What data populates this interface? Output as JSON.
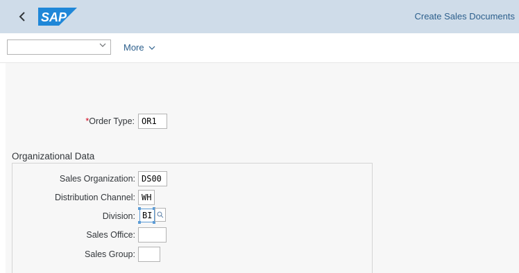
{
  "header": {
    "back_icon": "chevron-left-icon",
    "logo_text": "SAP",
    "title": "Create Sales Documents"
  },
  "toolbar": {
    "select_value": "",
    "more_label": "More"
  },
  "form": {
    "order_type": {
      "label": "Order Type:",
      "required": true,
      "value": "OR1"
    }
  },
  "organizational_data": {
    "title": "Organizational Data",
    "fields": [
      {
        "label": "Sales Organization:",
        "value": "DS00"
      },
      {
        "label": "Distribution Channel:",
        "value": "WH"
      },
      {
        "label": "Division:",
        "value": "BI"
      },
      {
        "label": "Sales Office:",
        "value": ""
      },
      {
        "label": "Sales Group:",
        "value": ""
      }
    ]
  },
  "colors": {
    "header_bg": "#cfdce9",
    "accent": "#2c5f8c",
    "required": "#d0021b"
  }
}
